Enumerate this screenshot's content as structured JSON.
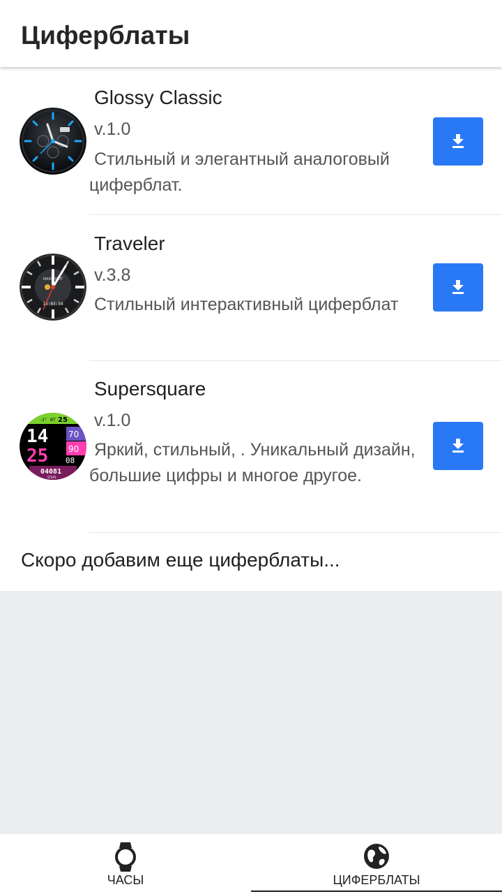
{
  "appbar": {
    "title": "Циферблаты"
  },
  "watchfaces": [
    {
      "name": "Glossy Classic",
      "version": "v.1.0",
      "description": "Стильный и элегантный аналоговый циферблат.",
      "thumb_icon": "glossy-classic-watchface-icon",
      "action_icon": "download-icon"
    },
    {
      "name": "Traveler",
      "version": "v.3.8",
      "description": "Стильный интерактивный циферблат",
      "thumb_icon": "traveler-watchface-icon",
      "thumb_text": {
        "brand": "MARSHRUT",
        "time": "16:03:34"
      },
      "action_icon": "download-icon"
    },
    {
      "name": "Supersquare",
      "version": "v.1.0",
      "description": "Яркий, стильный, . Уникальный дизайн, большие цифры и многое другое.",
      "thumb_icon": "supersquare-watchface-icon",
      "thumb_text": {
        "hours": "14",
        "minutes": "25",
        "seconds": "08",
        "temp": "-1°",
        "day": "ВТ",
        "date": "25",
        "battery": "70",
        "heart": "90",
        "steps": "04081",
        "steps_label": "STEPS"
      },
      "action_icon": "download-icon"
    }
  ],
  "footer_note": "Скоро добавим еще циферблаты...",
  "bottom_nav": {
    "tabs": [
      {
        "label": "ЧАСЫ",
        "icon": "watch-icon",
        "active": false
      },
      {
        "label": "ЦИФЕРБЛАТЫ",
        "icon": "watchface-globe-icon",
        "active": true
      }
    ]
  },
  "colors": {
    "accent": "#2979f6",
    "empty_area": "#eaeef1",
    "title_text": "#262626",
    "secondary_text": "#555555"
  }
}
